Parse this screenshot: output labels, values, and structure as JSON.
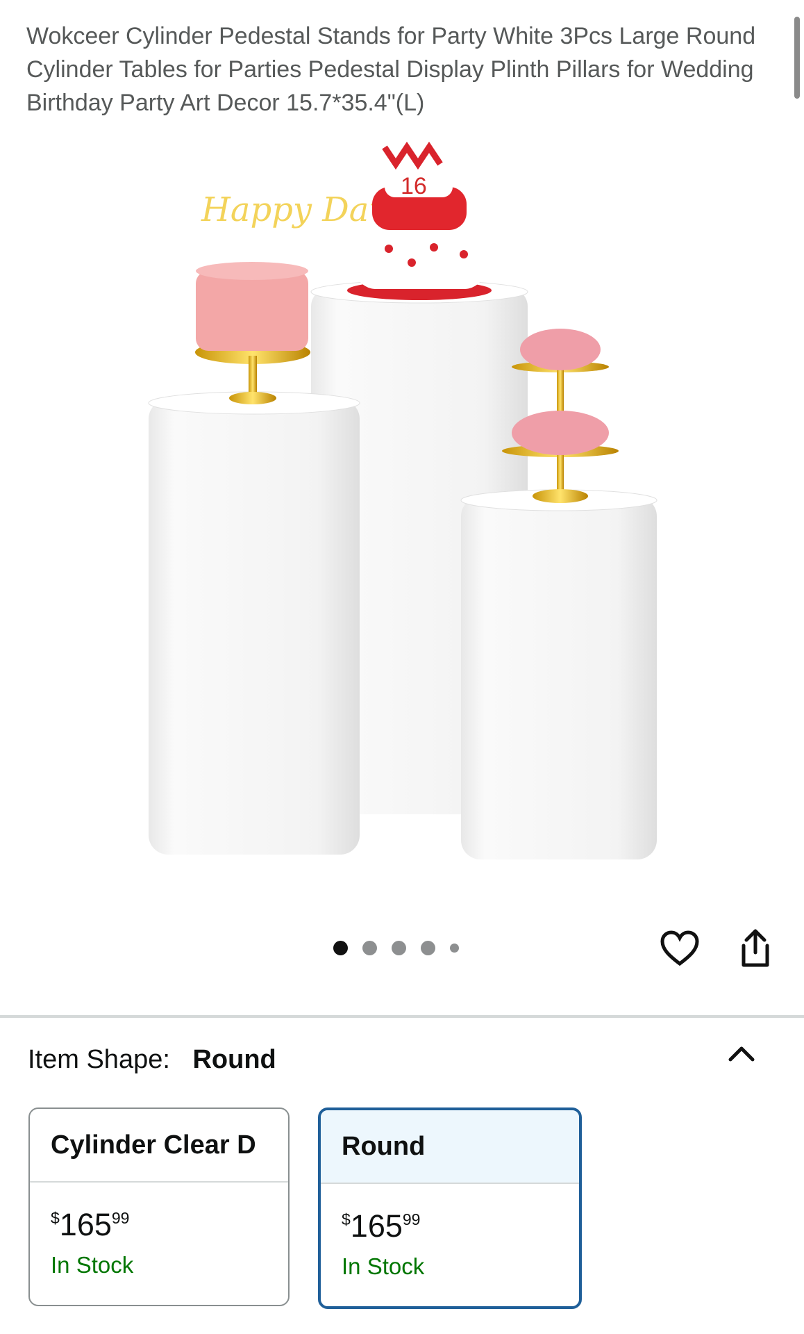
{
  "product": {
    "title": "Wokceer Cylinder Pedestal Stands for Party White 3Pcs Large Round Cylinder Tables for Parties Pedestal Display Plinth Pillars for Wedding Birthday Party Art Decor 15.7*35.4\"(L)"
  },
  "image": {
    "cake_topper_text": "Happy Days",
    "cake_number_text": "16",
    "carousel_dot_count": 5,
    "carousel_active_index": 0
  },
  "actions": {
    "wishlist_icon": "heart-icon",
    "share_icon": "share-icon"
  },
  "variation": {
    "label": "Item Shape:",
    "selected_value": "Round",
    "expand_icon": "chevron-up-icon",
    "options": [
      {
        "name": "Cylinder Clear D",
        "currency": "$",
        "price_whole": "165",
        "price_fraction": "99",
        "stock": "In Stock",
        "selected": false
      },
      {
        "name": "Round",
        "currency": "$",
        "price_whole": "165",
        "price_fraction": "99",
        "stock": "In Stock",
        "selected": true
      }
    ]
  },
  "colors": {
    "selected_border": "#1f5f99",
    "selected_fill": "#edf7fd",
    "stock_green": "#007600"
  }
}
